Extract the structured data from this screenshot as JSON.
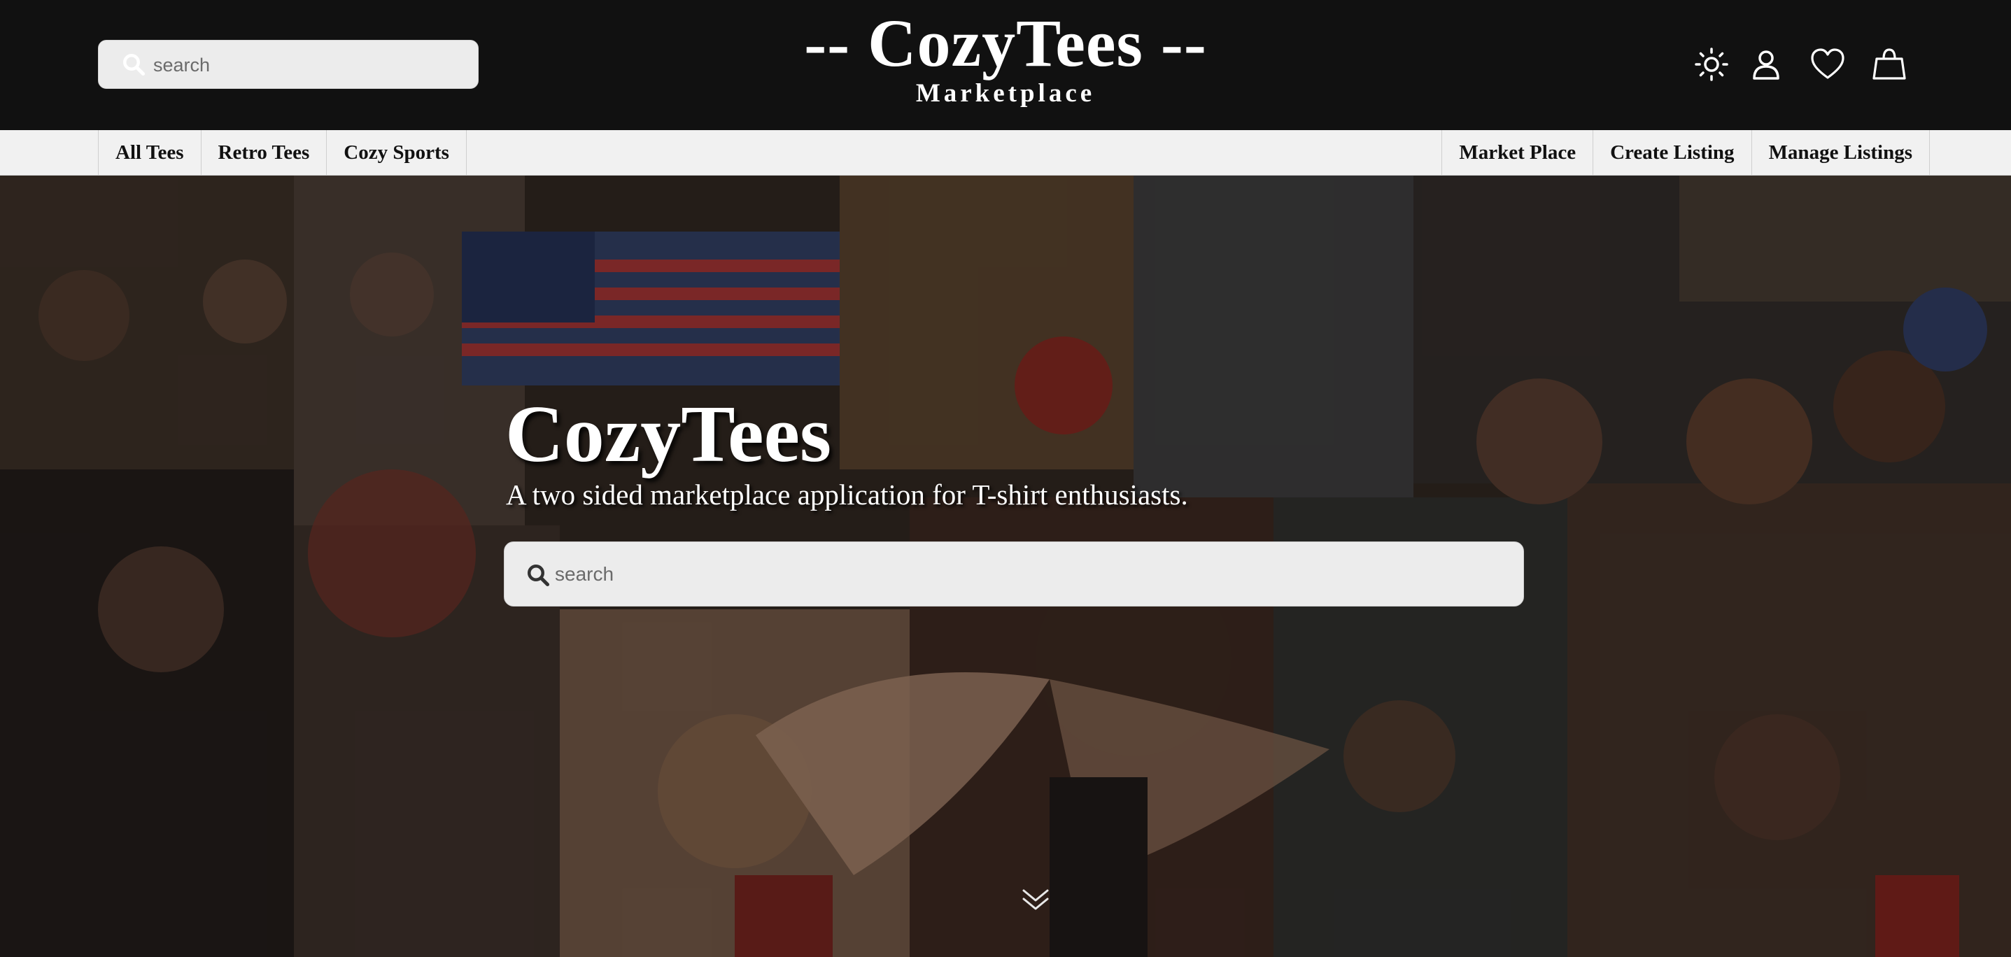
{
  "header": {
    "search_placeholder": "search",
    "brand_title": "-- CozyTees --",
    "brand_subtitle": "Marketplace",
    "icons": [
      "sun-icon",
      "user-icon",
      "heart-icon",
      "shopping-bag-icon"
    ]
  },
  "nav": {
    "left": [
      "All Tees",
      "Retro Tees",
      "Cozy Sports"
    ],
    "right": [
      "Market Place",
      "Create Listing",
      "Manage Listings"
    ]
  },
  "hero": {
    "title": "CozyTees",
    "subtitle": "A two sided marketplace application for T-shirt enthusiasts.",
    "search_placeholder": "search",
    "scroll_icon": "double-chevron-down-icon"
  },
  "colors": {
    "topbar": "#111111",
    "navbar": "#f1f1f1",
    "search_bg": "#ececec",
    "text_light": "#ffffff",
    "text_dark": "#111111"
  }
}
